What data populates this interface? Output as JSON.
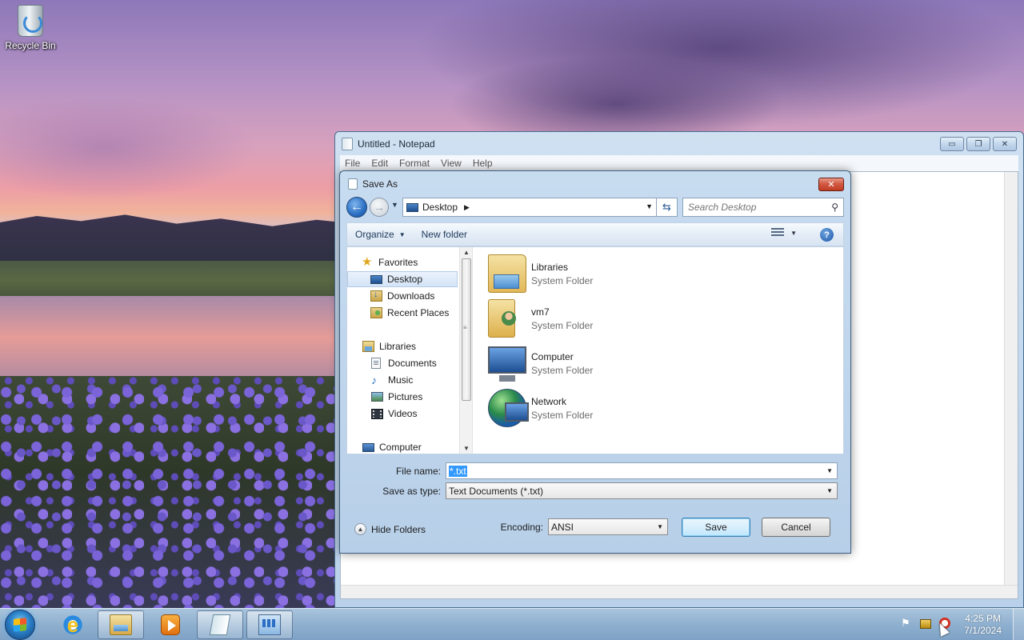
{
  "desktop": {
    "icons": [
      {
        "label": "Recycle Bin",
        "icon": "recycle-bin-icon"
      }
    ]
  },
  "notepad": {
    "title": "Untitled - Notepad",
    "menu": [
      "File",
      "Edit",
      "Format",
      "View",
      "Help"
    ],
    "window_buttons": {
      "minimize": "▭",
      "maximize": "❐",
      "close": "✕"
    }
  },
  "save_dialog": {
    "title": "Save As",
    "close_glyph": "✕",
    "address": {
      "location": "Desktop"
    },
    "search": {
      "placeholder": "Search Desktop"
    },
    "toolbar": {
      "organize_label": "Organize",
      "new_folder_label": "New folder",
      "help_glyph": "?"
    },
    "nav_pane": {
      "items": [
        {
          "label": "Favorites",
          "icon": "star-icon",
          "level": 0,
          "selected": false
        },
        {
          "label": "Desktop",
          "icon": "desktop-icon",
          "level": 1,
          "selected": true
        },
        {
          "label": "Downloads",
          "icon": "downloads-icon",
          "level": 1,
          "selected": false
        },
        {
          "label": "Recent Places",
          "icon": "recent-places-icon",
          "level": 1,
          "selected": false
        },
        {
          "label": "Libraries",
          "icon": "libraries-icon",
          "level": 0,
          "selected": false
        },
        {
          "label": "Documents",
          "icon": "documents-icon",
          "level": 1,
          "selected": false
        },
        {
          "label": "Music",
          "icon": "music-icon",
          "level": 1,
          "selected": false
        },
        {
          "label": "Pictures",
          "icon": "pictures-icon",
          "level": 1,
          "selected": false
        },
        {
          "label": "Videos",
          "icon": "videos-icon",
          "level": 1,
          "selected": false
        },
        {
          "label": "Computer",
          "icon": "computer-icon",
          "level": 0,
          "selected": false
        }
      ]
    },
    "content": {
      "items": [
        {
          "name": "Libraries",
          "type": "System Folder",
          "icon": "libraries-folder-icon"
        },
        {
          "name": "vm7",
          "type": "System Folder",
          "icon": "user-folder-icon"
        },
        {
          "name": "Computer",
          "type": "System Folder",
          "icon": "computer-icon"
        },
        {
          "name": "Network",
          "type": "System Folder",
          "icon": "network-icon"
        }
      ]
    },
    "file_name": {
      "label": "File name:",
      "value": "*.txt"
    },
    "save_as_type": {
      "label": "Save as type:",
      "value": "Text Documents (*.txt)"
    },
    "encoding": {
      "label": "Encoding:",
      "value": "ANSI"
    },
    "hide_folders_label": "Hide Folders",
    "save_label": "Save",
    "cancel_label": "Cancel"
  },
  "taskbar": {
    "apps": [
      {
        "name": "internet-explorer",
        "icon": "internet-explorer-icon",
        "open": false
      },
      {
        "name": "windows-explorer",
        "icon": "folder-icon",
        "open": true
      },
      {
        "name": "media-player",
        "icon": "media-player-icon",
        "open": false
      },
      {
        "name": "notepad",
        "icon": "notepad-icon",
        "open": true
      },
      {
        "name": "control-panel",
        "icon": "control-panel-icon",
        "open": true
      }
    ],
    "clock": {
      "time": "4:25 PM",
      "date": "7/1/2024"
    }
  },
  "colors": {
    "selection": "#3399ff",
    "dialog_frame": "#b7cfe8",
    "close_red": "#c03c24"
  }
}
